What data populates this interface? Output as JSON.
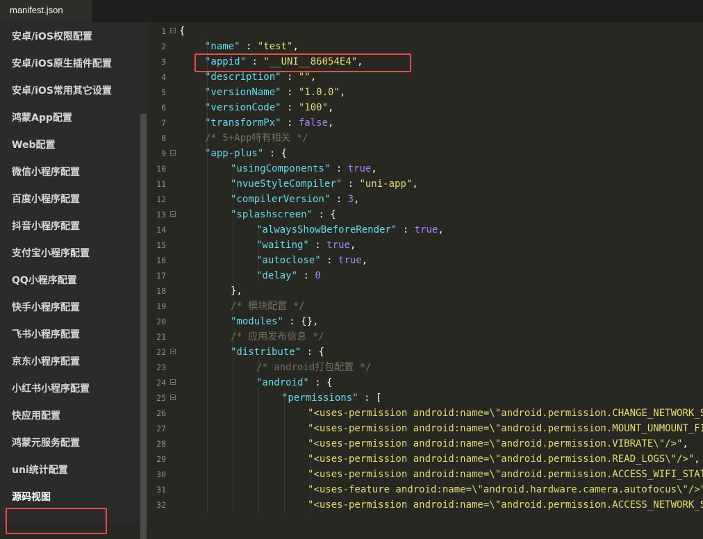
{
  "tab": {
    "title": "manifest.json"
  },
  "sidebar": {
    "items": [
      {
        "label": "安卓/iOS权限配置"
      },
      {
        "label": "安卓/iOS原生插件配置"
      },
      {
        "label": "安卓/iOS常用其它设置"
      },
      {
        "label": "鸿蒙App配置"
      },
      {
        "label": "Web配置"
      },
      {
        "label": "微信小程序配置"
      },
      {
        "label": "百度小程序配置"
      },
      {
        "label": "抖音小程序配置"
      },
      {
        "label": "支付宝小程序配置"
      },
      {
        "label": "QQ小程序配置"
      },
      {
        "label": "快手小程序配置"
      },
      {
        "label": "飞书小程序配置"
      },
      {
        "label": "京东小程序配置"
      },
      {
        "label": "小红书小程序配置"
      },
      {
        "label": "快应用配置"
      },
      {
        "label": "鸿蒙元服务配置"
      },
      {
        "label": "uni统计配置"
      },
      {
        "label": "源码视图",
        "active": true
      }
    ]
  },
  "editor": {
    "lines": [
      {
        "n": "1",
        "fold": true,
        "indent": 0,
        "t": [
          [
            "p",
            "{"
          ]
        ]
      },
      {
        "n": "2",
        "indent": 1,
        "t": [
          [
            "k",
            "\"name\""
          ],
          [
            "p",
            " : "
          ],
          [
            "s",
            "\"test\""
          ],
          [
            "p",
            ","
          ]
        ]
      },
      {
        "n": "3",
        "indent": 1,
        "t": [
          [
            "k",
            "\"appid\""
          ],
          [
            "p",
            " : "
          ],
          [
            "s",
            "\"__UNI__86054E4\""
          ],
          [
            "p",
            ","
          ]
        ]
      },
      {
        "n": "4",
        "indent": 1,
        "t": [
          [
            "k",
            "\"description\""
          ],
          [
            "p",
            " : "
          ],
          [
            "s",
            "\"\""
          ],
          [
            "p",
            ","
          ]
        ]
      },
      {
        "n": "5",
        "indent": 1,
        "t": [
          [
            "k",
            "\"versionName\""
          ],
          [
            "p",
            " : "
          ],
          [
            "s",
            "\"1.0.0\""
          ],
          [
            "p",
            ","
          ]
        ]
      },
      {
        "n": "6",
        "indent": 1,
        "t": [
          [
            "k",
            "\"versionCode\""
          ],
          [
            "p",
            " : "
          ],
          [
            "s",
            "\"100\""
          ],
          [
            "p",
            ","
          ]
        ]
      },
      {
        "n": "7",
        "indent": 1,
        "t": [
          [
            "k",
            "\"transformPx\""
          ],
          [
            "p",
            " : "
          ],
          [
            "n",
            "false"
          ],
          [
            "p",
            ","
          ]
        ]
      },
      {
        "n": "8",
        "indent": 1,
        "t": [
          [
            "c",
            "/* 5+App特有相关 */"
          ]
        ]
      },
      {
        "n": "9",
        "fold": true,
        "indent": 1,
        "t": [
          [
            "k",
            "\"app-plus\""
          ],
          [
            "p",
            " : {"
          ]
        ]
      },
      {
        "n": "10",
        "indent": 2,
        "t": [
          [
            "k",
            "\"usingComponents\""
          ],
          [
            "p",
            " : "
          ],
          [
            "n",
            "true"
          ],
          [
            "p",
            ","
          ]
        ]
      },
      {
        "n": "11",
        "indent": 2,
        "t": [
          [
            "k",
            "\"nvueStyleCompiler\""
          ],
          [
            "p",
            " : "
          ],
          [
            "s",
            "\"uni-app\""
          ],
          [
            "p",
            ","
          ]
        ]
      },
      {
        "n": "12",
        "indent": 2,
        "t": [
          [
            "k",
            "\"compilerVersion\""
          ],
          [
            "p",
            " : "
          ],
          [
            "n",
            "3"
          ],
          [
            "p",
            ","
          ]
        ]
      },
      {
        "n": "13",
        "fold": true,
        "indent": 2,
        "t": [
          [
            "k",
            "\"splashscreen\""
          ],
          [
            "p",
            " : {"
          ]
        ]
      },
      {
        "n": "14",
        "indent": 3,
        "t": [
          [
            "k",
            "\"alwaysShowBeforeRender\""
          ],
          [
            "p",
            " : "
          ],
          [
            "n",
            "true"
          ],
          [
            "p",
            ","
          ]
        ]
      },
      {
        "n": "15",
        "indent": 3,
        "t": [
          [
            "k",
            "\"waiting\""
          ],
          [
            "p",
            " : "
          ],
          [
            "n",
            "true"
          ],
          [
            "p",
            ","
          ]
        ]
      },
      {
        "n": "16",
        "indent": 3,
        "t": [
          [
            "k",
            "\"autoclose\""
          ],
          [
            "p",
            " : "
          ],
          [
            "n",
            "true"
          ],
          [
            "p",
            ","
          ]
        ]
      },
      {
        "n": "17",
        "indent": 3,
        "t": [
          [
            "k",
            "\"delay\""
          ],
          [
            "p",
            " : "
          ],
          [
            "n",
            "0"
          ]
        ]
      },
      {
        "n": "18",
        "indent": 2,
        "t": [
          [
            "p",
            "},"
          ]
        ]
      },
      {
        "n": "19",
        "indent": 2,
        "t": [
          [
            "c",
            "/* 模块配置 */"
          ]
        ]
      },
      {
        "n": "20",
        "indent": 2,
        "t": [
          [
            "k",
            "\"modules\""
          ],
          [
            "p",
            " : {},"
          ]
        ]
      },
      {
        "n": "21",
        "indent": 2,
        "t": [
          [
            "c",
            "/* 应用发布信息 */"
          ]
        ]
      },
      {
        "n": "22",
        "fold": true,
        "indent": 2,
        "t": [
          [
            "k",
            "\"distribute\""
          ],
          [
            "p",
            " : {"
          ]
        ]
      },
      {
        "n": "23",
        "indent": 3,
        "t": [
          [
            "c",
            "/* android打包配置 */"
          ]
        ]
      },
      {
        "n": "24",
        "fold": true,
        "indent": 3,
        "t": [
          [
            "k",
            "\"android\""
          ],
          [
            "p",
            " : {"
          ]
        ]
      },
      {
        "n": "25",
        "fold": true,
        "indent": 4,
        "t": [
          [
            "k",
            "\"permissions\""
          ],
          [
            "p",
            " : ["
          ]
        ]
      },
      {
        "n": "26",
        "indent": 5,
        "t": [
          [
            "s",
            "\"<uses-permission android:name=\\\"android.permission.CHANGE_NETWORK_STATE\\\"/>\""
          ],
          [
            "p",
            ","
          ]
        ]
      },
      {
        "n": "27",
        "indent": 5,
        "t": [
          [
            "s",
            "\"<uses-permission android:name=\\\"android.permission.MOUNT_UNMOUNT_FILESYSTEMS\\\"/>\""
          ],
          [
            "p",
            ","
          ]
        ]
      },
      {
        "n": "28",
        "indent": 5,
        "t": [
          [
            "s",
            "\"<uses-permission android:name=\\\"android.permission.VIBRATE\\\"/>\""
          ],
          [
            "p",
            ","
          ]
        ]
      },
      {
        "n": "29",
        "indent": 5,
        "t": [
          [
            "s",
            "\"<uses-permission android:name=\\\"android.permission.READ_LOGS\\\"/>\""
          ],
          [
            "p",
            ","
          ]
        ]
      },
      {
        "n": "30",
        "indent": 5,
        "t": [
          [
            "s",
            "\"<uses-permission android:name=\\\"android.permission.ACCESS_WIFI_STATE\\\"/>\""
          ],
          [
            "p",
            ","
          ]
        ]
      },
      {
        "n": "31",
        "indent": 5,
        "t": [
          [
            "s",
            "\"<uses-feature android:name=\\\"android.hardware.camera.autofocus\\\"/>\""
          ],
          [
            "p",
            ","
          ]
        ]
      },
      {
        "n": "32",
        "indent": 5,
        "t": [
          [
            "s",
            "\"<uses-permission android:name=\\\"android.permission.ACCESS_NETWORK_STATE\\\"/>\""
          ],
          [
            "p",
            ","
          ]
        ]
      }
    ]
  },
  "colors": {
    "highlight_border": "#e84c4c",
    "key": "#66d9ef",
    "string": "#e6db74",
    "comment": "#75715e",
    "literal": "#ae81ff"
  }
}
